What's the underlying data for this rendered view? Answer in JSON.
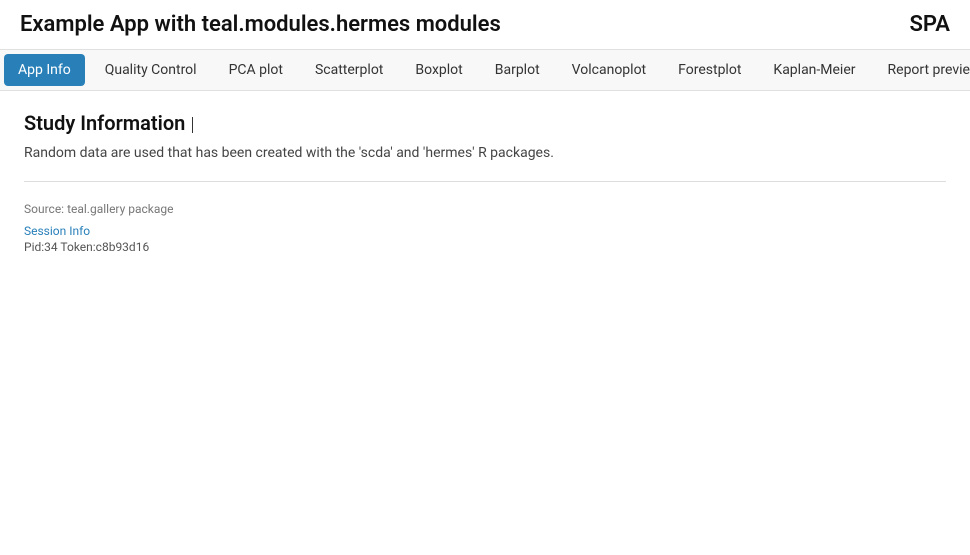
{
  "header": {
    "title": "Example App with teal.modules.hermes modules",
    "spa_label": "SPA"
  },
  "navbar": {
    "tabs": [
      {
        "id": "app-info",
        "label": "App Info",
        "active": true
      },
      {
        "id": "quality-control",
        "label": "Quality Control",
        "active": false
      },
      {
        "id": "pca-plot",
        "label": "PCA plot",
        "active": false
      },
      {
        "id": "scatterplot",
        "label": "Scatterplot",
        "active": false
      },
      {
        "id": "boxplot",
        "label": "Boxplot",
        "active": false
      },
      {
        "id": "barplot",
        "label": "Barplot",
        "active": false
      },
      {
        "id": "volcanoplot",
        "label": "Volcanoplot",
        "active": false
      },
      {
        "id": "forestplot",
        "label": "Forestplot",
        "active": false
      },
      {
        "id": "kaplan-meier",
        "label": "Kaplan-Meier",
        "active": false
      },
      {
        "id": "report-previewer",
        "label": "Report previewer",
        "active": false
      }
    ],
    "hamburger_icon": "≡"
  },
  "main": {
    "study_info": {
      "title": "Study Information",
      "description": "Random data are used that has been created with the 'scda' and 'hermes' R packages."
    }
  },
  "footer": {
    "source": "Source: teal.gallery package",
    "session_info_label": "Session Info",
    "session_info_detail": "Pid:34 Token:c8b93d16"
  }
}
